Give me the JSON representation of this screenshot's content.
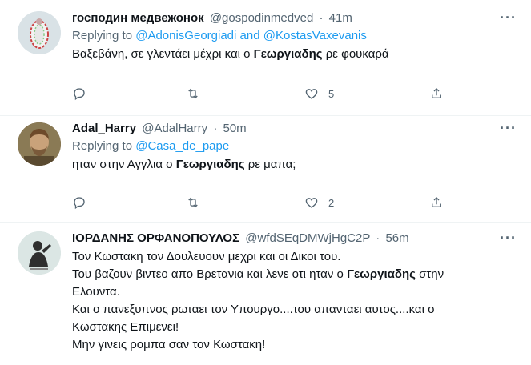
{
  "tweets": [
    {
      "name": "господин медвежонок",
      "handle": "@gospodinmedved",
      "time": "41m",
      "replying_prefix": "Replying to",
      "replying_links": "@AdonisGeorgiadi and @KostasVaxevanis",
      "text_before": "Βαξεβάνη, σε γλεντάει μέχρι και ο ",
      "text_bold": "Γεωργιαδης",
      "text_after": " ρε φουκαρά",
      "reply_count": "",
      "retweet_count": "",
      "like_count": "5"
    },
    {
      "name": "Adal_Harry",
      "handle": "@AdalHarry",
      "time": "50m",
      "replying_prefix": "Replying to",
      "replying_links": "@Casa_de_pape",
      "text_before": "ηταν στην Αγγλια ο ",
      "text_bold": "Γεωργιαδης",
      "text_after": " ρε μαπα;",
      "reply_count": "",
      "retweet_count": "",
      "like_count": "2"
    },
    {
      "name": "ΙΟΡΔΑΝΗΣ ΟΡΦΑΝΟΠΟΥΛΟΣ",
      "handle": "@wfdSEqDMWjHgC2P",
      "time": "56m",
      "line1": "Τον Κωστακη τον Δουλευουν μεχρι και οι Δικοι του.",
      "line2_before": "Του βαζουν βιντεο απο Βρετανια και λενε οτι ηταν ο ",
      "line2_bold": "Γεωργιαδης",
      "line2_after": " στην",
      "line3": "Ελουντα.",
      "line4": "Και ο πανεξυπνος ρωταει τον Υπουργο....του απανταει αυτος....και ο",
      "line5": "Κωστακης Επιμενει!",
      "line6": "Μην γινεις ρομπα σαν τον Κωστακη!"
    }
  ],
  "separator": "·",
  "more_label": "···",
  "colors": {
    "link": "#1d9bf0",
    "secondary": "#536471",
    "text": "#0f1419"
  },
  "icons": [
    "reply-icon",
    "retweet-icon",
    "like-icon",
    "share-icon",
    "more-icon"
  ]
}
